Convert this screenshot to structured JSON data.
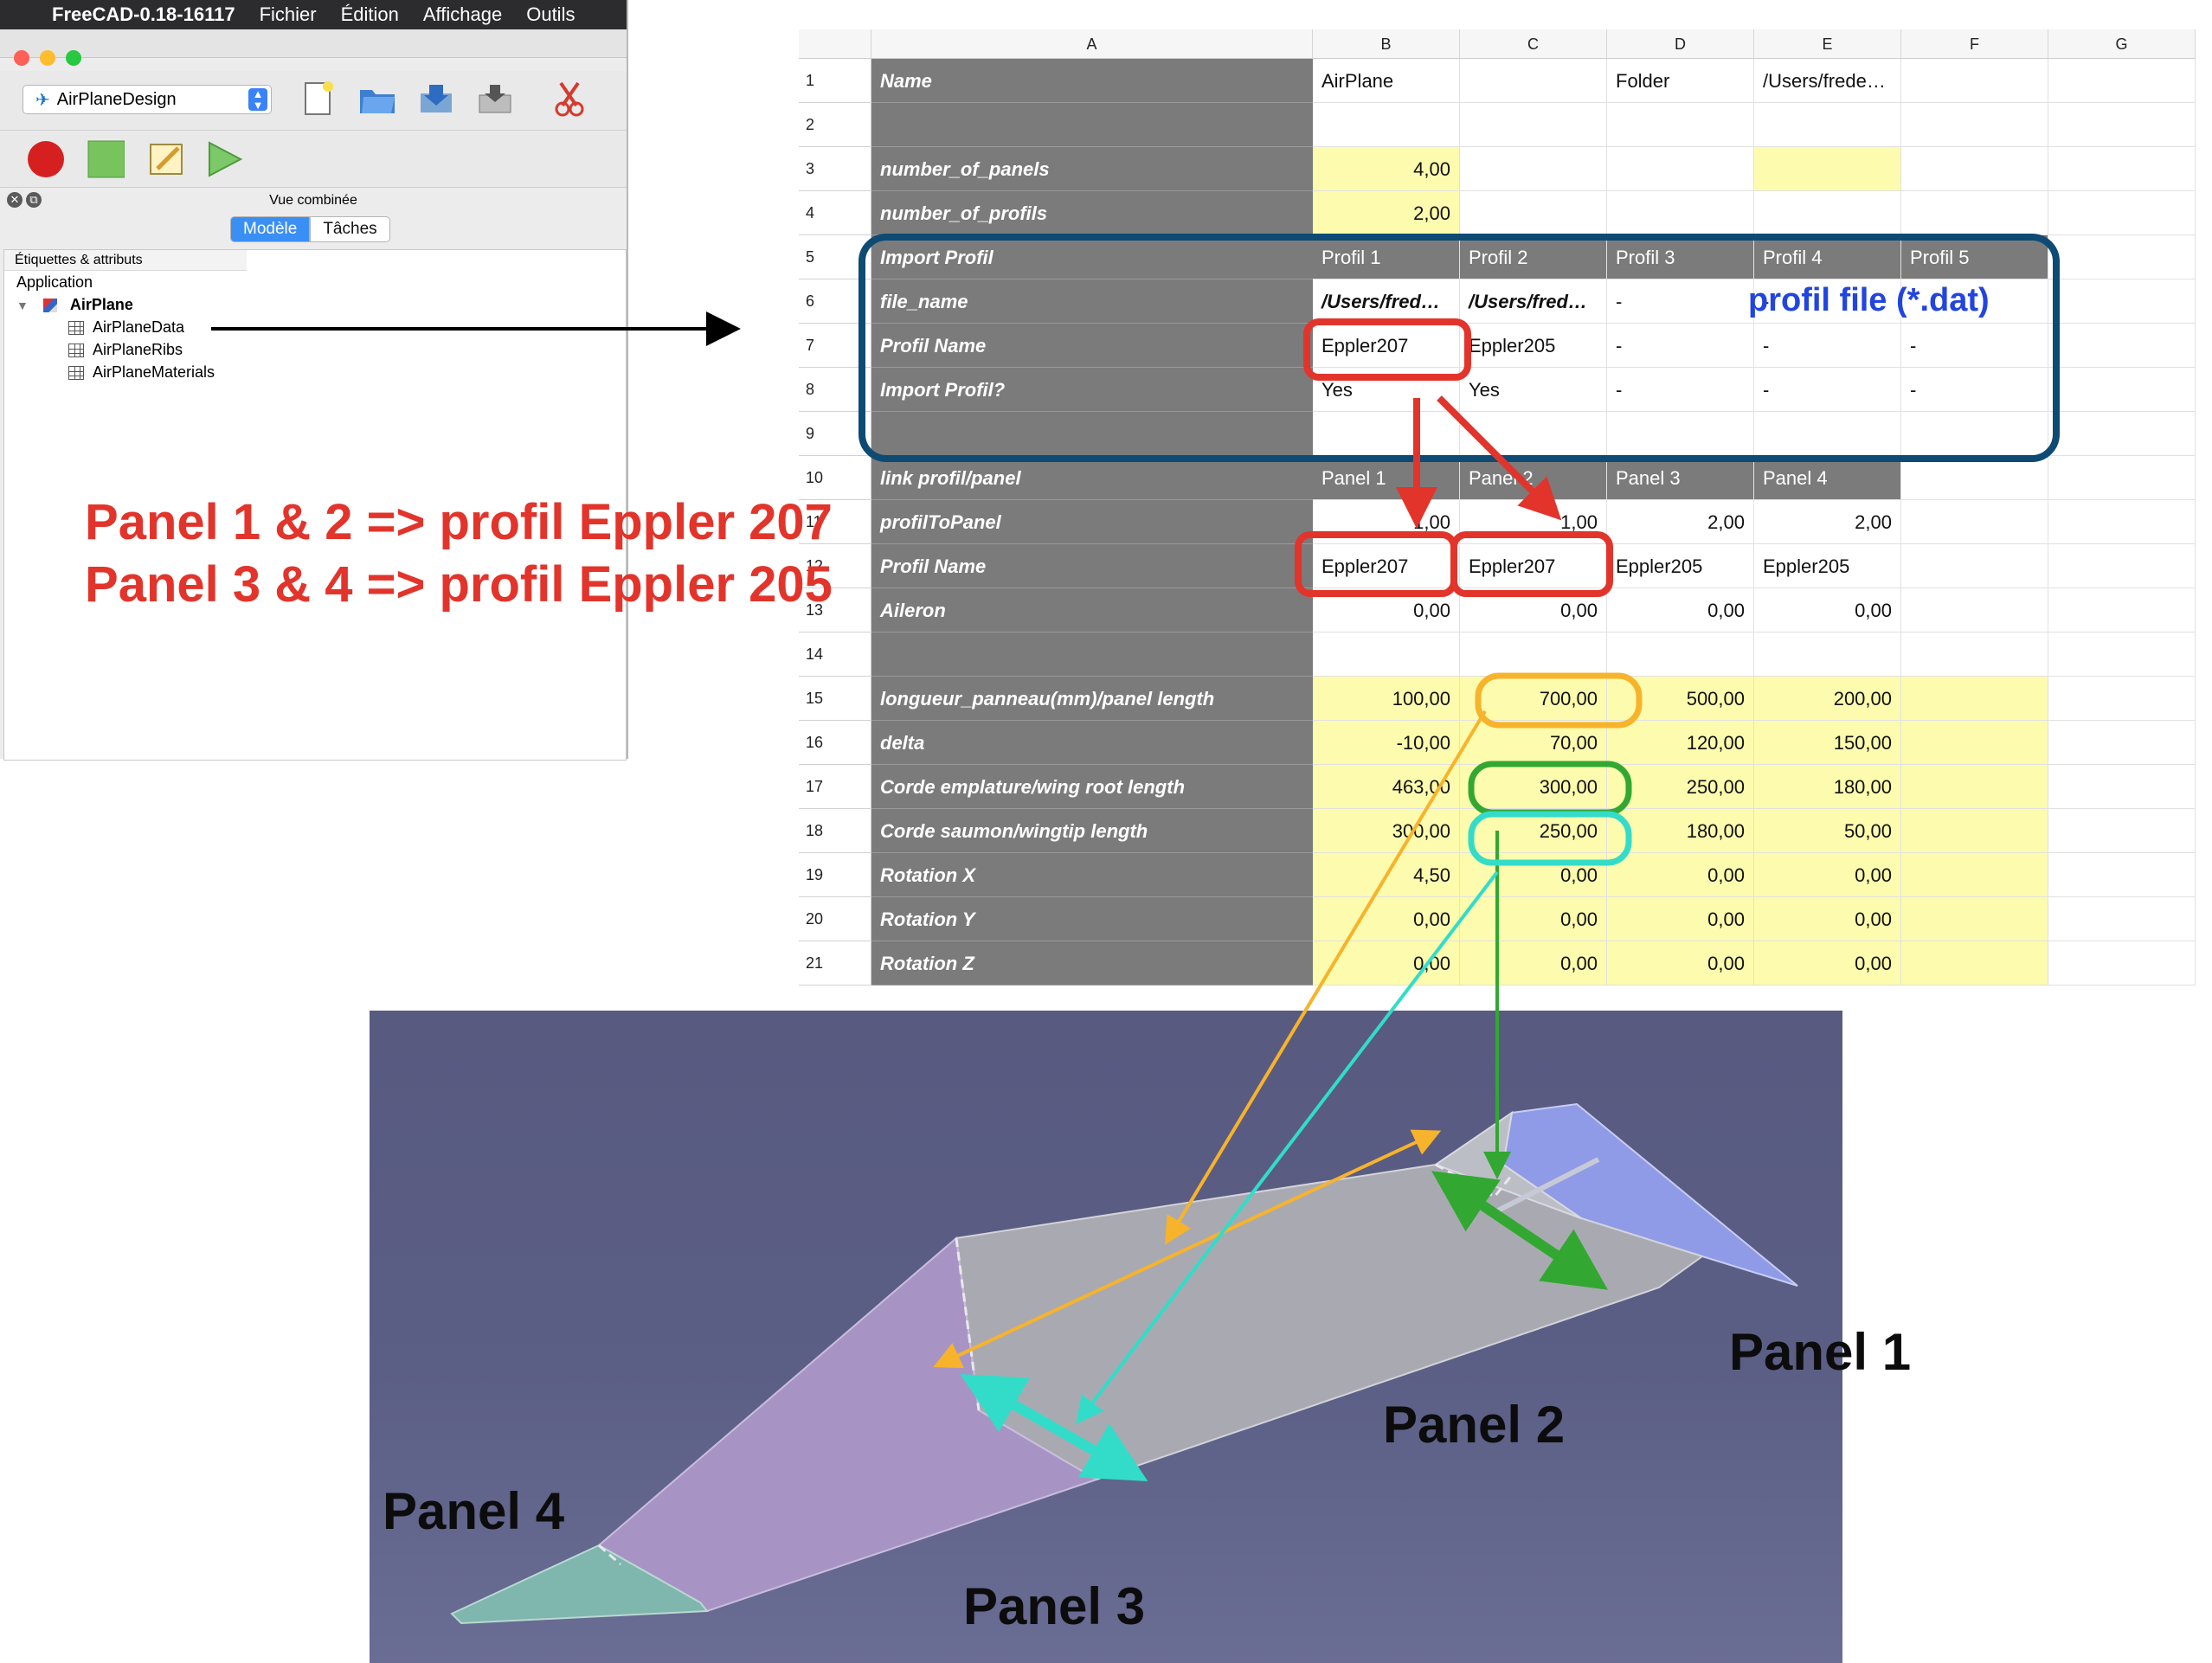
{
  "menubar": {
    "app": "FreeCAD-0.18-16117",
    "items": [
      "Fichier",
      "Édition",
      "Affichage",
      "Outils"
    ]
  },
  "toolbar": {
    "workbench": "AirPlaneDesign"
  },
  "combo_view": {
    "title": "Vue combinée",
    "tabs": [
      "Modèle",
      "Tâches"
    ]
  },
  "tree": {
    "header": "Étiquettes & attributs",
    "root": "Application",
    "document": "AirPlane",
    "children": [
      "AirPlaneData",
      "AirPlaneRibs",
      "AirPlaneMaterials"
    ]
  },
  "spreadsheet": {
    "columns": [
      "A",
      "B",
      "C",
      "D",
      "E",
      "F",
      "G"
    ],
    "rows": [
      {
        "n": "1",
        "label": "Name",
        "cells": [
          "AirPlane",
          "",
          "Folder",
          "/Users/frede…",
          ""
        ]
      },
      {
        "n": "2",
        "label": "",
        "cells": [
          "",
          "",
          "",
          "",
          ""
        ]
      },
      {
        "n": "3",
        "label": "number_of_panels",
        "cells": [
          "4,00",
          "",
          "",
          "",
          ""
        ]
      },
      {
        "n": "4",
        "label": "number_of_profils",
        "cells": [
          "2,00",
          "",
          "",
          "",
          ""
        ]
      },
      {
        "n": "5",
        "label": "Import Profil",
        "cells": [
          "Profil 1",
          "Profil 2",
          "Profil 3",
          "Profil 4",
          "Profil 5"
        ]
      },
      {
        "n": "6",
        "label": "file_name",
        "cells": [
          "/Users/fred…",
          "/Users/fred…",
          "-",
          "-",
          ""
        ]
      },
      {
        "n": "7",
        "label": "Profil Name",
        "cells": [
          "Eppler207",
          "Eppler205",
          "-",
          "-",
          "-"
        ]
      },
      {
        "n": "8",
        "label": "Import Profil?",
        "cells": [
          "Yes",
          "Yes",
          "-",
          "-",
          "-"
        ]
      },
      {
        "n": "9",
        "label": "",
        "cells": [
          "",
          "",
          "",
          "",
          ""
        ]
      },
      {
        "n": "10",
        "label": "link profil/panel",
        "cells": [
          "Panel 1",
          "Panel 2",
          "Panel 3",
          "Panel 4",
          ""
        ]
      },
      {
        "n": "11",
        "label": "profilToPanel",
        "cells": [
          "1,00",
          "1,00",
          "2,00",
          "2,00",
          ""
        ]
      },
      {
        "n": "12",
        "label": "Profil Name",
        "cells": [
          "Eppler207",
          "Eppler207",
          "Eppler205",
          "Eppler205",
          ""
        ]
      },
      {
        "n": "13",
        "label": "Aileron",
        "cells": [
          "0,00",
          "0,00",
          "0,00",
          "0,00",
          ""
        ]
      },
      {
        "n": "14",
        "label": "",
        "cells": [
          "",
          "",
          "",
          "",
          ""
        ]
      },
      {
        "n": "15",
        "label": "longueur_panneau(mm)/panel length",
        "cells": [
          "100,00",
          "700,00",
          "500,00",
          "200,00",
          ""
        ]
      },
      {
        "n": "16",
        "label": "delta",
        "cells": [
          "-10,00",
          "70,00",
          "120,00",
          "150,00",
          ""
        ]
      },
      {
        "n": "17",
        "label": "Corde emplature/wing root length",
        "cells": [
          "463,00",
          "300,00",
          "250,00",
          "180,00",
          ""
        ]
      },
      {
        "n": "18",
        "label": "Corde saumon/wingtip length",
        "cells": [
          "300,00",
          "250,00",
          "180,00",
          "50,00",
          ""
        ]
      },
      {
        "n": "19",
        "label": "Rotation X",
        "cells": [
          "4,50",
          "0,00",
          "0,00",
          "0,00",
          ""
        ]
      },
      {
        "n": "20",
        "label": "Rotation Y",
        "cells": [
          "0,00",
          "0,00",
          "0,00",
          "0,00",
          ""
        ]
      },
      {
        "n": "21",
        "label": "Rotation Z",
        "cells": [
          "0,00",
          "0,00",
          "0,00",
          "0,00",
          ""
        ]
      }
    ]
  },
  "annotations": {
    "mapping_line1": "Panel 1 & 2  => profil Eppler 207",
    "mapping_line2": "Panel 3 & 4 => profil Eppler 205",
    "profil_file_note": "profil file (*.dat)",
    "panel_labels": [
      "Panel 1",
      "Panel 2",
      "Panel 3",
      "Panel 4"
    ]
  },
  "colors": {
    "annotation_red": "#e2342b",
    "annotation_blue": "#2244e0",
    "frame_dark_blue": "#0d4a74",
    "panel_length_orange": "#f7b32b",
    "root_chord_green": "#32a832",
    "tip_chord_cyan": "#33dcc8",
    "input_yellow": "#fdfbad",
    "label_grey": "#7b7b7b"
  }
}
